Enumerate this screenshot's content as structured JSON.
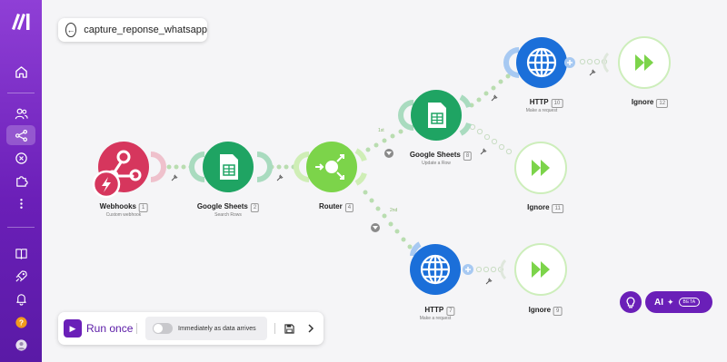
{
  "scenario": {
    "title": "capture_reponse_whatsapp"
  },
  "sidebar": {
    "items": [
      {
        "name": "home",
        "icon": "home-icon"
      },
      {
        "name": "team",
        "icon": "users-icon"
      },
      {
        "name": "scenarios",
        "icon": "share-icon",
        "active": true
      },
      {
        "name": "connections",
        "icon": "link-icon"
      },
      {
        "name": "apps",
        "icon": "puzzle-icon"
      },
      {
        "name": "more",
        "icon": "more-vertical-icon"
      },
      {
        "name": "resource-hub",
        "icon": "book-icon"
      },
      {
        "name": "whats-new",
        "icon": "rocket-icon"
      },
      {
        "name": "notifications",
        "icon": "bell-icon"
      },
      {
        "name": "help",
        "icon": "help-icon"
      },
      {
        "name": "profile",
        "icon": "avatar"
      }
    ]
  },
  "modules": {
    "webhooks": {
      "title": "Webhooks",
      "num": "1",
      "sub": "Custom webhook",
      "color": "#d6365d"
    },
    "sheets_search": {
      "title": "Google Sheets",
      "num": "2",
      "sub": "Search Rows",
      "color": "#1fa463"
    },
    "router": {
      "title": "Router",
      "num": "4",
      "color": "#7cd44a"
    },
    "sheets_update": {
      "title": "Google Sheets",
      "num": "8",
      "sub": "Update a Row",
      "color": "#1fa463"
    },
    "http_top": {
      "title": "HTTP",
      "num": "10",
      "sub": "Make a request",
      "color": "#1b6fd9"
    },
    "ignore_top": {
      "title": "Ignore",
      "num": "12"
    },
    "ignore_mid": {
      "title": "Ignore",
      "num": "11"
    },
    "http_bottom": {
      "title": "HTTP",
      "num": "7",
      "sub": "Make a request",
      "color": "#1b6fd9"
    },
    "ignore_bottom": {
      "title": "Ignore",
      "num": "9"
    }
  },
  "route_labels": {
    "upper": "1st",
    "lower": "2nd"
  },
  "bottom_bar": {
    "run_label": "Run once",
    "schedule_label": "Immediately as data arrives",
    "schedule_on": false
  },
  "ai": {
    "label": "AI",
    "badge": "BETA"
  },
  "colors": {
    "accent": "#6a1fb8",
    "sidebar_top": "#8f3fd6",
    "canvas": "#f5f5f7",
    "connector": "#b9ddb0"
  }
}
